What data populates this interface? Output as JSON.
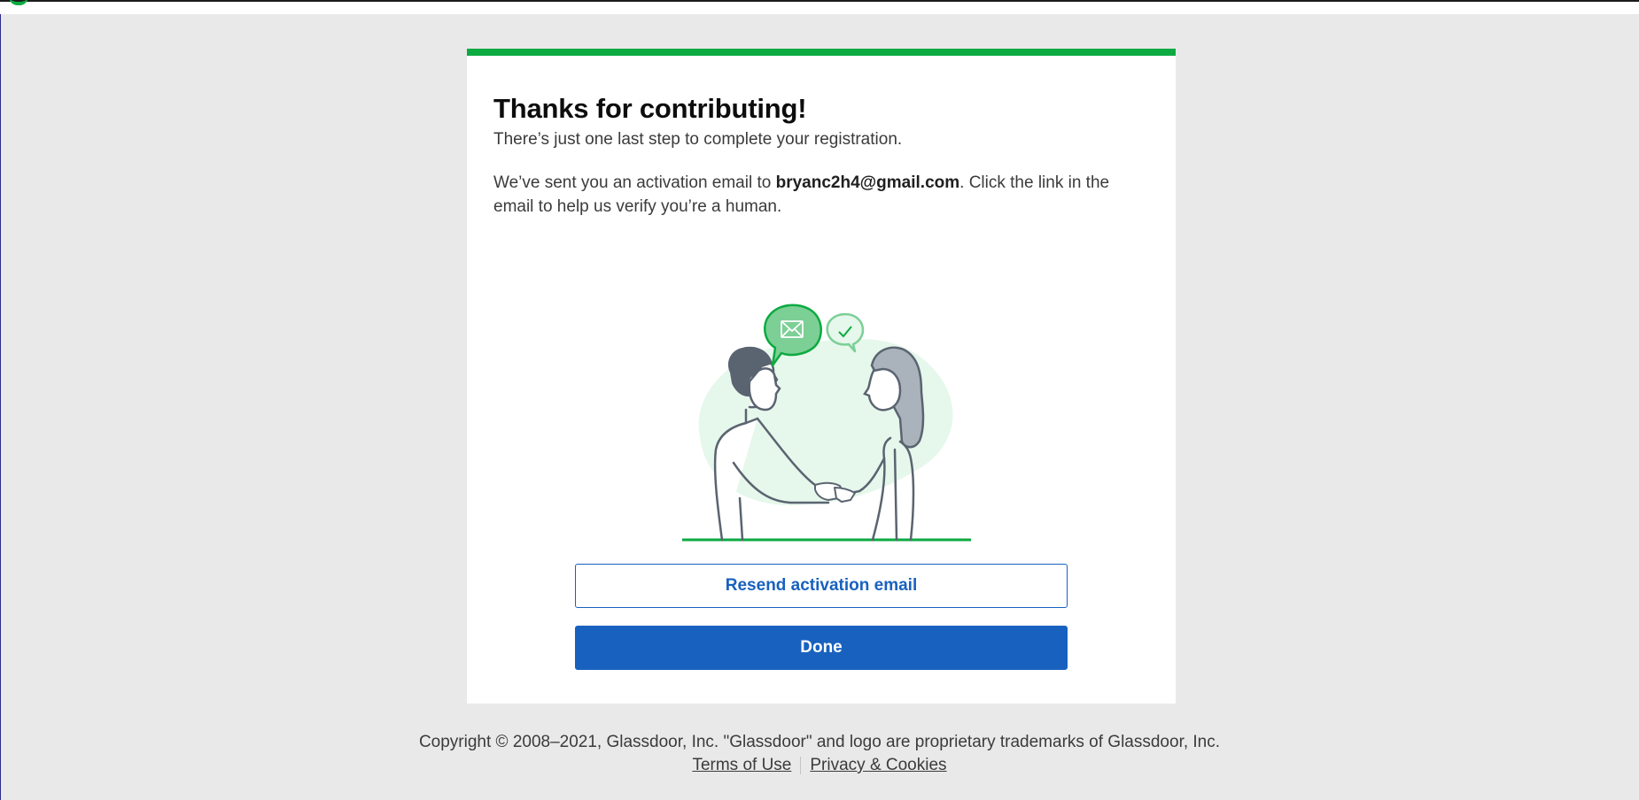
{
  "card": {
    "title": "Thanks for contributing!",
    "subtitle": "There’s just one last step to complete your registration.",
    "message_before": "We’ve sent you an activation email to ",
    "email": "bryanc2h4@gmail.com",
    "message_after": ". Click the link in the email to help us verify you’re a human."
  },
  "illustration": {
    "icons": [
      "envelope-icon",
      "checkmark-icon"
    ]
  },
  "buttons": {
    "resend_label": "Resend activation email",
    "done_label": "Done"
  },
  "footer": {
    "copyright": "Copyright © 2008–2021, Glassdoor, Inc. \"Glassdoor\" and logo are proprietary trademarks of Glassdoor, Inc.",
    "terms_label": "Terms of Use",
    "privacy_label": "Privacy & Cookies"
  },
  "colors": {
    "brand_green": "#0caa41",
    "primary_blue": "#1861bf",
    "page_background": "#e9e9e9"
  }
}
